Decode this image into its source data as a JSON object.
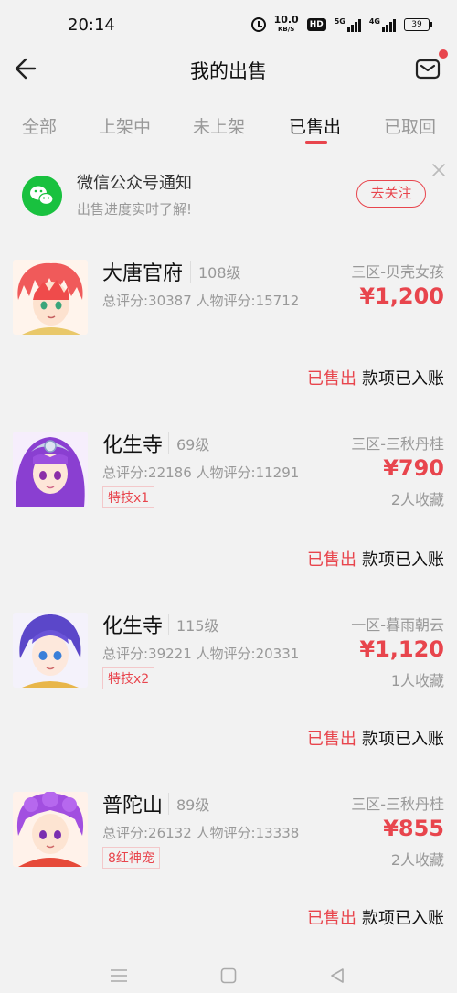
{
  "status_bar": {
    "time": "20:14",
    "net_speed_value": "10.0",
    "net_speed_unit": "KB/S",
    "hd_label": "HD",
    "sim1_type": "5G",
    "sim2_type": "4G",
    "battery": "39"
  },
  "header": {
    "title": "我的出售"
  },
  "tabs": [
    {
      "label": "全部",
      "active": false
    },
    {
      "label": "上架中",
      "active": false
    },
    {
      "label": "未上架",
      "active": false
    },
    {
      "label": "已售出",
      "active": true
    },
    {
      "label": "已取回",
      "active": false
    }
  ],
  "notice": {
    "title": "微信公众号通知",
    "subtitle": "出售进度实时了解!",
    "button": "去关注"
  },
  "items": [
    {
      "name": "大唐官府",
      "level": "108级",
      "scores": "总评分:30387   人物评分:15712",
      "tag": "",
      "server": "三区-贝壳女孩",
      "price": "¥1,200",
      "favorites": "",
      "status_sold": "已售出",
      "status_paid": "款项已入账"
    },
    {
      "name": "化生寺",
      "level": "69级",
      "scores": "总评分:22186   人物评分:11291",
      "tag": "特技x1",
      "server": "三区-三秋丹桂",
      "price": "¥790",
      "favorites": "2人收藏",
      "status_sold": "已售出",
      "status_paid": "款项已入账"
    },
    {
      "name": "化生寺",
      "level": "115级",
      "scores": "总评分:39221   人物评分:20331",
      "tag": "特技x2",
      "server": "一区-暮雨朝云",
      "price": "¥1,120",
      "favorites": "1人收藏",
      "status_sold": "已售出",
      "status_paid": "款项已入账"
    },
    {
      "name": "普陀山",
      "level": "89级",
      "scores": "总评分:26132   人物评分:13338",
      "tag": "8红神宠",
      "server": "三区-三秋丹桂",
      "price": "¥855",
      "favorites": "2人收藏",
      "status_sold": "已售出",
      "status_paid": "款项已入账"
    }
  ],
  "colors": {
    "accent": "#e8454d",
    "wechat": "#19c13f",
    "background": "#f2f2f2"
  },
  "icons": [
    "back-arrow-icon",
    "mail-icon",
    "wechat-icon",
    "close-icon",
    "menu-nav-icon",
    "home-nav-icon",
    "back-nav-icon"
  ]
}
